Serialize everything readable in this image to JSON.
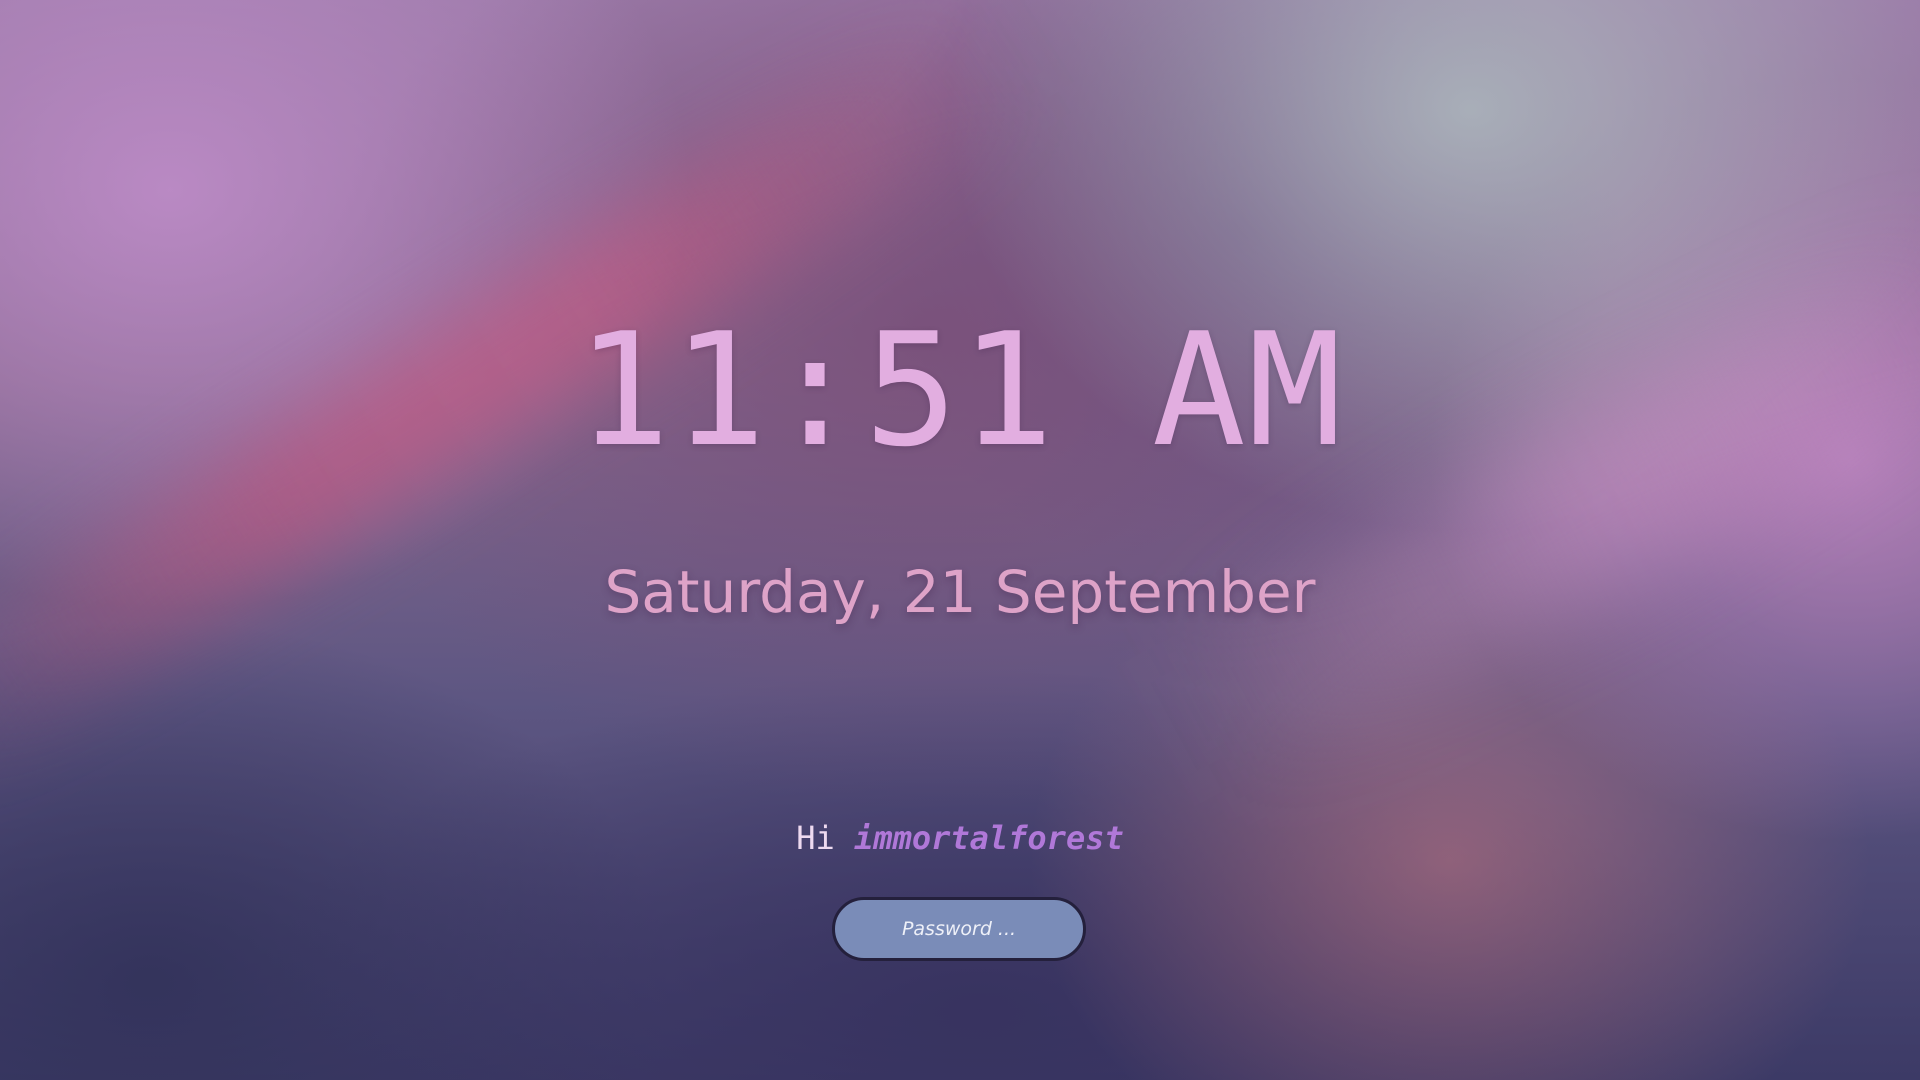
{
  "lockscreen": {
    "time": "11:51 AM",
    "date": "Saturday, 21 September",
    "greeting_prefix": "Hi",
    "username": "immortalforest",
    "password_placeholder": "Password ..."
  },
  "colors": {
    "clock": "#e2aee0",
    "date": "#dea3c8",
    "username": "#b078d8",
    "password_field_bg": "#7a8cb8",
    "password_field_border": "#24203c"
  }
}
